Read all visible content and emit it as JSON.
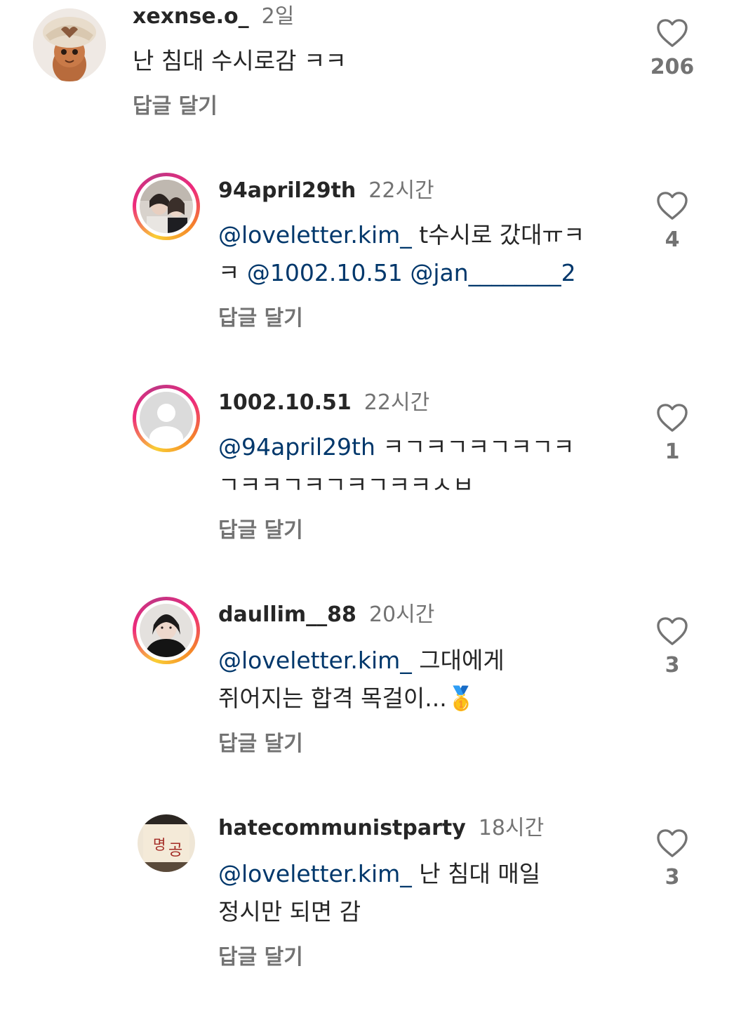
{
  "comments": [
    {
      "username": "xexnse.o_",
      "time": "2일",
      "text": "난 침대 수시로감 ㅋㅋ",
      "reply_label": "답글 달기",
      "likes": "206"
    },
    {
      "username": "94april29th",
      "time": "22시간",
      "mention": "@loveletter.kim_",
      "text_line1_rest": " t수시로 갔대ㅠㅋ",
      "text_line2_prefix": "ㅋ ",
      "mention2": "@1002.10.51",
      "mention3": "@jan________2",
      "reply_label": "답글 달기",
      "likes": "4"
    },
    {
      "username": "1002.10.51",
      "time": "22시간",
      "mention": "@94april29th",
      "text_line1_rest": " ㅋㄱㅋㄱㅋㄱㅋㄱㅋ",
      "text_line2": "ㄱㅋㅋㄱㅋㄱㅋㄱㅋㅋㅅㅂ",
      "reply_label": "답글 달기",
      "likes": "1"
    },
    {
      "username": "daullim__88",
      "time": "20시간",
      "mention": "@loveletter.kim_",
      "text_line1_rest": " 그대에게",
      "text_line2": "쥐어지는 합격 목걸이...🥇",
      "reply_label": "답글 달기",
      "likes": "3"
    },
    {
      "username": "hatecommunistparty",
      "time": "18시간",
      "mention": "@loveletter.kim_",
      "text_line1_rest": " 난 침대 매일",
      "text_line2": "정시만 되면 감",
      "reply_label": "답글 달기",
      "likes": "3"
    }
  ],
  "colors": {
    "text": "#262626",
    "secondary": "#737373",
    "mention": "#00376b"
  }
}
